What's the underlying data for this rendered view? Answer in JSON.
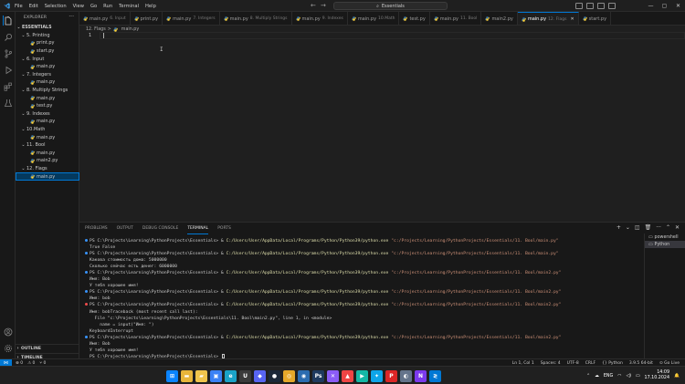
{
  "menubar": {
    "items": [
      "File",
      "Edit",
      "Selection",
      "View",
      "Go",
      "Run",
      "Terminal",
      "Help"
    ]
  },
  "command_center": {
    "text": "Essentials"
  },
  "icons": {
    "activity": [
      "files-icon",
      "search-icon",
      "source-control-icon",
      "run-debug-icon",
      "extensions-icon",
      "testing-icon"
    ],
    "bottom": [
      "account-icon",
      "gear-icon"
    ]
  },
  "sidebar": {
    "title": "EXPLORER",
    "tree": [
      {
        "label": "ESSENTIALS",
        "kind": "root",
        "depth": 0,
        "open": true
      },
      {
        "label": "5. Printing",
        "kind": "folder",
        "depth": 1,
        "open": true
      },
      {
        "label": "print.py",
        "kind": "file",
        "depth": 2
      },
      {
        "label": "start.py",
        "kind": "file",
        "depth": 2
      },
      {
        "label": "6. Input",
        "kind": "folder",
        "depth": 1,
        "open": true
      },
      {
        "label": "main.py",
        "kind": "file",
        "depth": 2
      },
      {
        "label": "7. Integers",
        "kind": "folder",
        "depth": 1,
        "open": true
      },
      {
        "label": "main.py",
        "kind": "file",
        "depth": 2
      },
      {
        "label": "8. Multiply Strings",
        "kind": "folder",
        "depth": 1,
        "open": true
      },
      {
        "label": "main.py",
        "kind": "file",
        "depth": 2
      },
      {
        "label": "test.py",
        "kind": "file",
        "depth": 2
      },
      {
        "label": "9. Indexes",
        "kind": "folder",
        "depth": 1,
        "open": true
      },
      {
        "label": "main.py",
        "kind": "file",
        "depth": 2
      },
      {
        "label": "10.Math",
        "kind": "folder",
        "depth": 1,
        "open": true
      },
      {
        "label": "main.py",
        "kind": "file",
        "depth": 2
      },
      {
        "label": "11. Bool",
        "kind": "folder",
        "depth": 1,
        "open": true
      },
      {
        "label": "main.py",
        "kind": "file",
        "depth": 2
      },
      {
        "label": "main2.py",
        "kind": "file",
        "depth": 2
      },
      {
        "label": "12. Flags",
        "kind": "folder",
        "depth": 1,
        "open": true
      },
      {
        "label": "main.py",
        "kind": "file",
        "depth": 2,
        "selected": true
      }
    ],
    "outline_label": "OUTLINE",
    "timeline_label": "TIMELINE"
  },
  "tabs": [
    {
      "label": "main.py",
      "desc": "6. Input"
    },
    {
      "label": "print.py",
      "desc": ""
    },
    {
      "label": "main.py",
      "desc": "7. Integers"
    },
    {
      "label": "main.py",
      "desc": "8. Multiply Strings"
    },
    {
      "label": "main.py",
      "desc": "9. Indexes"
    },
    {
      "label": "main.py",
      "desc": "10.Math"
    },
    {
      "label": "test.py",
      "desc": ""
    },
    {
      "label": "main.py",
      "desc": "11. Bool"
    },
    {
      "label": "main2.py",
      "desc": ""
    },
    {
      "label": "main.py",
      "desc": "12. Flags",
      "active": true
    },
    {
      "label": "start.py",
      "desc": ""
    }
  ],
  "breadcrumb": {
    "folder": "12. Flags",
    "sep": ">",
    "file": "main.py"
  },
  "editor": {
    "line_number": "1"
  },
  "panel": {
    "tabs": [
      "PROBLEMS",
      "OUTPUT",
      "DEBUG CONSOLE",
      "TERMINAL",
      "PORTS"
    ],
    "active_tab": "TERMINAL",
    "terminals": [
      "powershell",
      "Python"
    ],
    "lines": [
      {
        "dot": "blue",
        "prompt": "PS C:\\Projects\\Learning\\PythonProjects\\Essentials> & ",
        "exe": "C:/Users/User/AppData/Local/Programs/Python/Python39/python.exe",
        "arg": " \"c:/Projects/Learning/PythonProjects/Essentials/11. Bool/main.py\""
      },
      {
        "out": "True False"
      },
      {
        "dot": "blue",
        "prompt": "PS C:\\Projects\\Learning\\PythonProjects\\Essentials> & ",
        "exe": "C:/Users/User/AppData/Local/Programs/Python/Python39/python.exe",
        "arg": " \"c:/Projects/Learning/PythonProjects/Essentials/11. Bool/main.py\""
      },
      {
        "out": "Какова стоимость дома: 5000000"
      },
      {
        "out": "Сколько сейчас есть денег: 6000000"
      },
      {
        "dot": "blue",
        "prompt": "PS C:\\Projects\\Learning\\PythonProjects\\Essentials> & ",
        "exe": "C:/Users/User/AppData/Local/Programs/Python/Python39/python.exe",
        "arg": " \"c:/Projects/Learning/PythonProjects/Essentials/11. Bool/main2.py\""
      },
      {
        "out": "Имя: Bob"
      },
      {
        "out": "У тебя хорошее имя!"
      },
      {
        "dot": "blue",
        "prompt": "PS C:\\Projects\\Learning\\PythonProjects\\Essentials> & ",
        "exe": "C:/Users/User/AppData/Local/Programs/Python/Python39/python.exe",
        "arg": " \"c:/Projects/Learning/PythonProjects/Essentials/11. Bool/main2.py\""
      },
      {
        "out": "Имя: bob"
      },
      {
        "dot": "red",
        "prompt": "PS C:\\Projects\\Learning\\PythonProjects\\Essentials> & ",
        "exe": "C:/Users/User/AppData/Local/Programs/Python/Python39/python.exe",
        "arg": " \"c:/Projects/Learning/PythonProjects/Essentials/11. Bool/main2.py\""
      },
      {
        "out": "Имя: bobTraceback (most recent call last):"
      },
      {
        "out": "  File \"c:\\Projects\\Learning\\PythonProjects\\Essentials\\11. Bool\\main2.py\", line 1, in <module>"
      },
      {
        "out": "    name = input(\"Имя: \")"
      },
      {
        "out": "KeyboardInterrupt"
      },
      {
        "dot": "blue",
        "prompt": "PS C:\\Projects\\Learning\\PythonProjects\\Essentials> & ",
        "exe": "C:/Users/User/AppData/Local/Programs/Python/Python39/python.exe",
        "arg": " \"c:/Projects/Learning/PythonProjects/Essentials/11. Bool/main2.py\""
      },
      {
        "out": "Имя: Bob"
      },
      {
        "out": "У тебя хорошее имя!"
      },
      {
        "dot": "none",
        "prompt": "PS C:\\Projects\\Learning\\PythonProjects\\Essentials> ",
        "exe": "",
        "arg": "",
        "cursor": true
      }
    ]
  },
  "statusbar": {
    "errors": "⊗ 0",
    "warnings": "⚠ 0",
    "ports": "⑂ 0",
    "right": [
      "Ln 1, Col 1",
      "Spaces: 4",
      "UTF-8",
      "CRLF",
      "{} Python",
      "3.9.5 64-bit",
      "⊙ Go Live"
    ]
  },
  "taskbar": {
    "apps": [
      {
        "name": "windows-start-icon",
        "glyph": "⊞",
        "color": "#0a84ff"
      },
      {
        "name": "file-explorer-icon",
        "glyph": "▬",
        "color": "#e8b53a"
      },
      {
        "name": "folder-icon",
        "glyph": "▰",
        "color": "#f0c44c"
      },
      {
        "name": "store-icon",
        "glyph": "▣",
        "color": "#3b82f6"
      },
      {
        "name": "edge-icon",
        "glyph": "e",
        "color": "#1aa3c8"
      },
      {
        "name": "unreal-icon",
        "glyph": "U",
        "color": "#3a3a3a"
      },
      {
        "name": "app-icon",
        "glyph": "◆",
        "color": "#5865f2"
      },
      {
        "name": "steam-icon",
        "glyph": "●",
        "color": "#1b2838"
      },
      {
        "name": "chrome-icon",
        "glyph": "◎",
        "color": "#e5a82a"
      },
      {
        "name": "app-icon",
        "glyph": "◉",
        "color": "#2b6cb0"
      },
      {
        "name": "photoshop-icon",
        "glyph": "Ps",
        "color": "#1f3a5f"
      },
      {
        "name": "app-icon",
        "glyph": "✕",
        "color": "#8b5cf6"
      },
      {
        "name": "app-icon",
        "glyph": "▲",
        "color": "#ef4444"
      },
      {
        "name": "app-icon",
        "glyph": "▶",
        "color": "#14b8a6"
      },
      {
        "name": "app-icon",
        "glyph": "✦",
        "color": "#0ea5e9"
      },
      {
        "name": "app-icon",
        "glyph": "P",
        "color": "#dc2626"
      },
      {
        "name": "app-icon",
        "glyph": "◐",
        "color": "#64748b"
      },
      {
        "name": "app-icon",
        "glyph": "N",
        "color": "#7c3aed"
      },
      {
        "name": "vscode-icon",
        "glyph": "≷",
        "color": "#0078d4"
      }
    ],
    "lang": "ENG",
    "time": "14:09",
    "date": "17.10.2024"
  },
  "colors": {
    "accent": "#0078d4",
    "editor_bg": "#1f1f1f",
    "sidebar_bg": "#181818",
    "folder_label": "#cccccc"
  }
}
